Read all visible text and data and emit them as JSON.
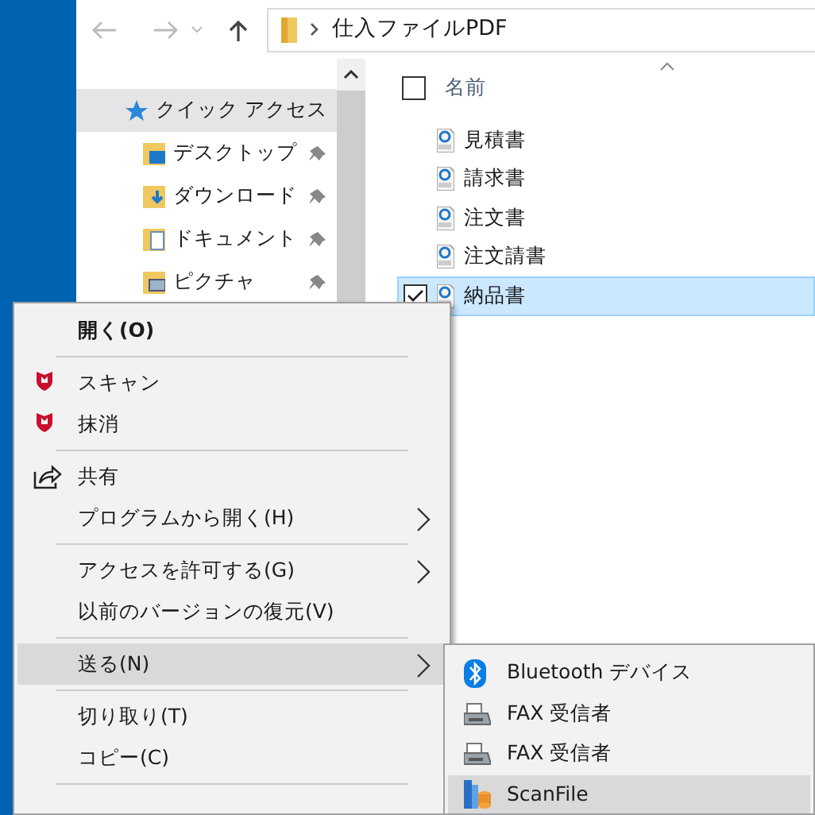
{
  "address_bar": {
    "path": "仕入ファイルPDF"
  },
  "navigation_pane": {
    "items": [
      {
        "label": "クイック アクセス",
        "selected": true,
        "children": [
          {
            "label": "デスクトップ",
            "selected": false
          },
          {
            "label": "ダウンロード",
            "selected": false
          },
          {
            "label": "ドキュメント",
            "selected": false
          },
          {
            "label": "ピクチャ",
            "selected": false
          }
        ]
      }
    ]
  },
  "file_list": {
    "column_header": "名前",
    "select_all_checked": false,
    "files": [
      {
        "name": "見積書",
        "selected": false
      },
      {
        "name": "請求書",
        "selected": false
      },
      {
        "name": "注文書",
        "selected": false
      },
      {
        "name": "注文請書",
        "selected": false
      },
      {
        "name": "納品書",
        "selected": true
      }
    ]
  },
  "context_menu": {
    "items": [
      {
        "kind": "command",
        "label": "開く(O)",
        "bold": true,
        "has_submenu": false,
        "selected": false
      },
      {
        "kind": "separator"
      },
      {
        "kind": "command",
        "label": "スキャン",
        "bold": false,
        "has_submenu": false,
        "selected": false
      },
      {
        "kind": "command",
        "label": "抹消",
        "bold": false,
        "has_submenu": false,
        "selected": false
      },
      {
        "kind": "separator"
      },
      {
        "kind": "command",
        "label": "共有",
        "bold": false,
        "has_submenu": false,
        "selected": false
      },
      {
        "kind": "command",
        "label": "プログラムから開く(H)",
        "bold": false,
        "has_submenu": true,
        "selected": false
      },
      {
        "kind": "separator"
      },
      {
        "kind": "command",
        "label": "アクセスを許可する(G)",
        "bold": false,
        "has_submenu": true,
        "selected": false
      },
      {
        "kind": "command",
        "label": "以前のバージョンの復元(V)",
        "bold": false,
        "has_submenu": false,
        "selected": false
      },
      {
        "kind": "separator"
      },
      {
        "kind": "command",
        "label": "送る(N)",
        "bold": false,
        "has_submenu": true,
        "selected": true
      },
      {
        "kind": "separator"
      },
      {
        "kind": "command",
        "label": "切り取り(T)",
        "bold": false,
        "has_submenu": false,
        "selected": false
      },
      {
        "kind": "command",
        "label": "コピー(C)",
        "bold": false,
        "has_submenu": false,
        "selected": false
      },
      {
        "kind": "separator"
      }
    ]
  },
  "send_to_submenu": {
    "items": [
      {
        "label": "Bluetooth デバイス",
        "selected": false
      },
      {
        "label": "FAX 受信者",
        "selected": false
      },
      {
        "label": "FAX 受信者",
        "selected": false
      },
      {
        "label": "ScanFile",
        "selected": true
      }
    ]
  }
}
